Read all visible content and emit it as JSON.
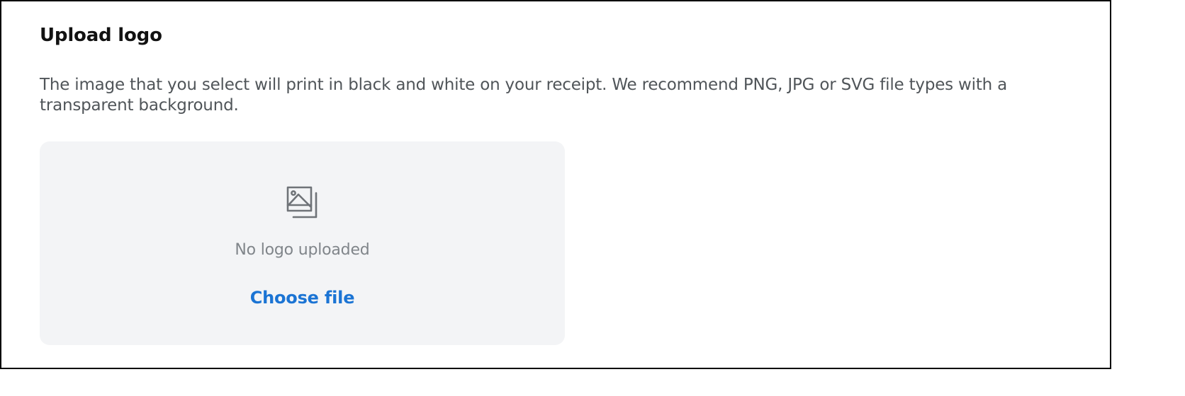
{
  "section": {
    "title": "Upload logo",
    "description": "The image that you select will print in black and white on your receipt. We recommend PNG, JPG or SVG file types with a transparent background."
  },
  "dropzone": {
    "icon": "image-stack-icon",
    "empty_label": "No logo uploaded",
    "choose_file_label": "Choose file"
  },
  "colors": {
    "accent": "#1b74d4",
    "dropzone_bg": "#f3f4f6",
    "muted_text": "#80858a",
    "body_text": "#505559",
    "title_text": "#121212"
  }
}
